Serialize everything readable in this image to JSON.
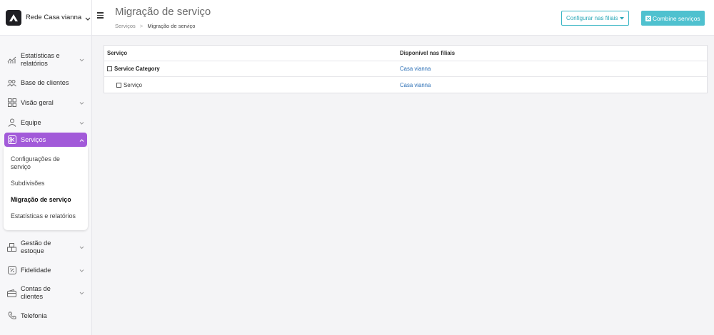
{
  "brand": {
    "name": "Rede Casa vianna"
  },
  "header": {
    "title": "Migração de serviço",
    "breadcrumb": [
      "Serviços",
      ">",
      "Migração de serviço"
    ],
    "btn_configure": "Configurar nas filiais",
    "btn_combine": "Combine serviços"
  },
  "sidebar": {
    "items": [
      {
        "label": "Estatísticas e relatórios",
        "icon": "chart-icon"
      },
      {
        "label": "Base de clientes",
        "icon": "users-icon"
      },
      {
        "label": "Visão geral",
        "icon": "grid-icon"
      },
      {
        "label": "Equipe",
        "icon": "user-icon"
      },
      {
        "label": "Serviços",
        "icon": "scissors-icon"
      },
      {
        "label": "Gestão de estoque",
        "icon": "boxes-icon"
      },
      {
        "label": "Fidelidade",
        "icon": "percent-icon"
      },
      {
        "label": "Contas de clientes",
        "icon": "wallet-icon"
      },
      {
        "label": "Telefonia",
        "icon": "phone-icon"
      }
    ],
    "submenu": [
      "Configurações de serviço",
      "Subdivisões",
      "Migração de serviço",
      "Estatísticas e relatórios"
    ]
  },
  "table": {
    "headers": [
      "Serviço",
      "Disponível nas filiais"
    ],
    "rows": [
      {
        "name": "Service Category",
        "branch": "Casa vianna"
      },
      {
        "name": "Serviço",
        "branch": "Casa vianna"
      }
    ]
  },
  "colors": {
    "accent": "#a25ad9",
    "teal": "#4fc1cf",
    "link": "#2b6fb5"
  }
}
